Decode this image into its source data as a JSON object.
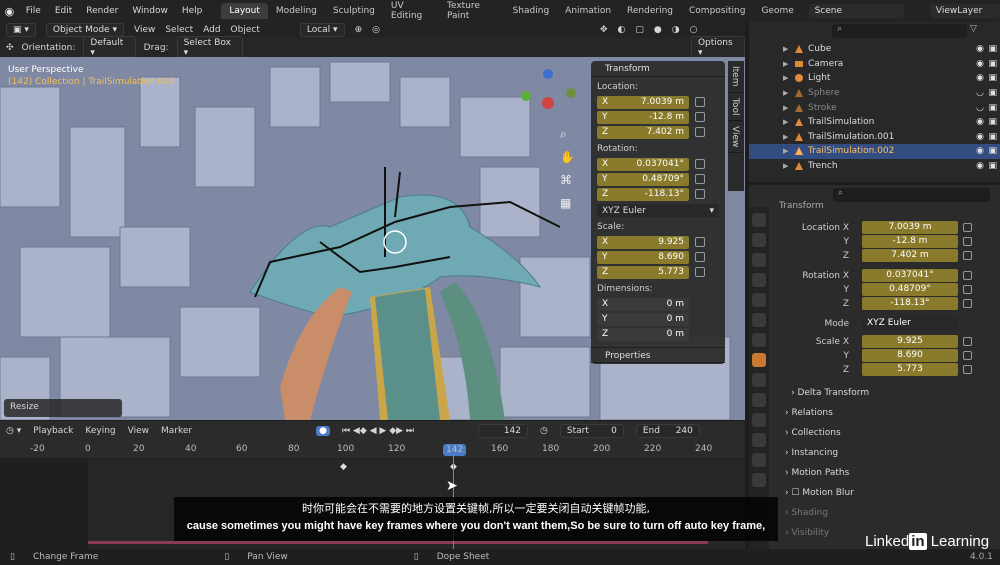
{
  "topbar": {
    "menus": [
      "File",
      "Edit",
      "Render",
      "Window",
      "Help"
    ],
    "workspaces": [
      "Layout",
      "Modeling",
      "Sculpting",
      "UV Editing",
      "Texture Paint",
      "Shading",
      "Animation",
      "Rendering",
      "Compositing",
      "Geome"
    ],
    "active_workspace": "Layout",
    "scene": "Scene",
    "view_layer": "ViewLayer"
  },
  "viewport_header": {
    "mode": "Object Mode",
    "menus": [
      "View",
      "Select",
      "Add",
      "Object"
    ],
    "transform_orientation": "Local",
    "options_label": "Options"
  },
  "tool_settings": {
    "orientation_label": "Orientation:",
    "orientation_value": "Default",
    "drag_label": "Drag:",
    "drag_value": "Select Box"
  },
  "viewport": {
    "view_name": "User Perspective",
    "collection_info": "(142) Collection | TrailSimulation.002",
    "resize_label": "Resize"
  },
  "npanel": {
    "title": "Transform",
    "location_label": "Location:",
    "location": {
      "x": "7.0039 m",
      "y": "-12.8 m",
      "z": "7.402 m"
    },
    "rotation_label": "Rotation:",
    "rotation": {
      "x": "0.037041°",
      "y": "0.48709°",
      "z": "-118.13°"
    },
    "rotation_mode": "XYZ Euler",
    "scale_label": "Scale:",
    "scale": {
      "x": "9.925",
      "y": "8.690",
      "z": "5.773"
    },
    "dimensions_label": "Dimensions:",
    "dimensions": {
      "x": "0 m",
      "y": "0 m",
      "z": "0 m"
    },
    "properties_label": "Properties",
    "axis": {
      "x": "X",
      "y": "Y",
      "z": "Z"
    },
    "side_tabs": [
      "Item",
      "Tool",
      "View"
    ]
  },
  "timeline": {
    "menus": [
      "Playback",
      "Keying",
      "View",
      "Marker"
    ],
    "current_frame": "142",
    "start_label": "Start",
    "start": "0",
    "end_label": "End",
    "end": "240",
    "ruler": [
      "-20",
      "0",
      "20",
      "40",
      "60",
      "80",
      "100",
      "120",
      "142",
      "160",
      "180",
      "200",
      "220",
      "240"
    ]
  },
  "status": {
    "items": [
      "Change Frame",
      "Pan View",
      "Dope Sheet"
    ],
    "version": "4.0.1"
  },
  "outliner": {
    "rows": [
      {
        "name": "Cube",
        "selected": false
      },
      {
        "name": "Camera",
        "selected": false
      },
      {
        "name": "Light",
        "selected": false
      },
      {
        "name": "Sphere",
        "selected": false
      },
      {
        "name": "Stroke",
        "selected": false
      },
      {
        "name": "TrailSimulation",
        "selected": false
      },
      {
        "name": "TrailSimulation.001",
        "selected": false
      },
      {
        "name": "TrailSimulation.002",
        "selected": true
      },
      {
        "name": "Trench",
        "selected": false
      }
    ]
  },
  "properties": {
    "section_partial": "Transform",
    "location_x_label": "Location X",
    "rotation_x_label": "Rotation X",
    "scale_x_label": "Scale X",
    "y_label": "Y",
    "z_label": "Z",
    "mode_label": "Mode",
    "mode_value": "XYZ Euler",
    "location": [
      "7.0039 m",
      "-12.8 m",
      "7.402 m"
    ],
    "rotation": [
      "0.037041°",
      "0.48709°",
      "-118.13°"
    ],
    "scale": [
      "9.925",
      "8.690",
      "5.773"
    ],
    "sections": [
      "Delta Transform",
      "Relations",
      "Collections",
      "Instancing",
      "Motion Paths",
      "Motion Blur",
      "Shading",
      "Visibility"
    ]
  },
  "subtitle": {
    "chinese": "时你可能会在不需要的地方设置关键帧,所以一定要关闭自动关键帧功能,",
    "english": "cause sometimes you might have key frames where you don't want them,So be sure to turn off auto key frame,"
  },
  "brand": {
    "linked": "Linked",
    "in": "in",
    "learning": " Learning"
  },
  "colors": {
    "accent_blue": "#4a7cc7",
    "field_yellow": "#8a7a2c",
    "selected_row": "#334d80"
  }
}
